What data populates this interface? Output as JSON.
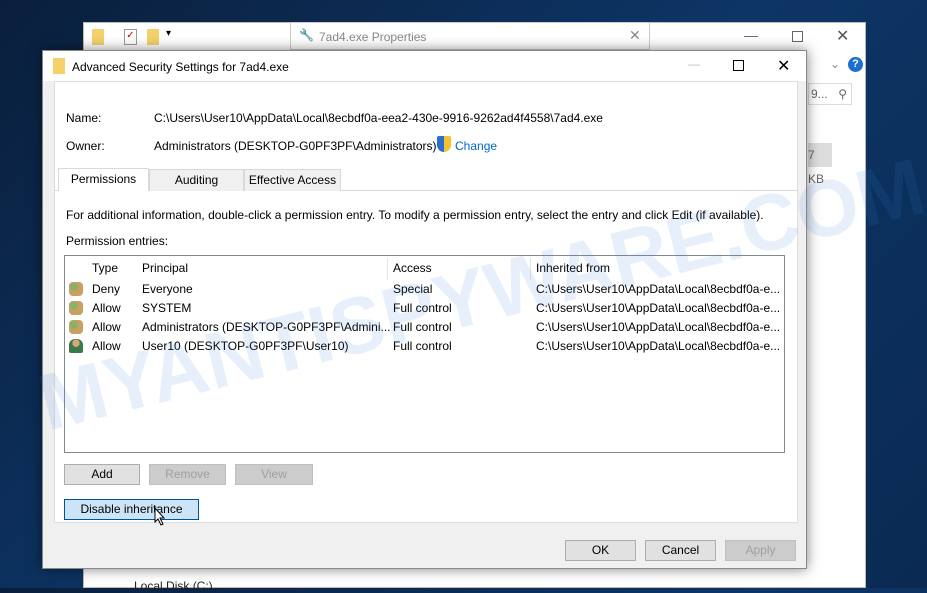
{
  "explorer": {
    "props_title": "7ad4.exe Properties",
    "search_text": "9...",
    "size_text": "7 KB",
    "nav_item": "Local Disk (C:)"
  },
  "dialog": {
    "title": "Advanced Security Settings for 7ad4.exe",
    "name_label": "Name:",
    "name_value": "C:\\Users\\User10\\AppData\\Local\\8ecbdf0a-eea2-430e-9916-9262ad4f4558\\7ad4.exe",
    "owner_label": "Owner:",
    "owner_value": "Administrators (DESKTOP-G0PF3PF\\Administrators)",
    "change_link": "Change",
    "tabs": [
      {
        "label": "Permissions"
      },
      {
        "label": "Auditing"
      },
      {
        "label": "Effective Access"
      }
    ],
    "info_text": "For additional information, double-click a permission entry. To modify a permission entry, select the entry and click Edit (if available).",
    "entries_label": "Permission entries:",
    "columns": [
      "Type",
      "Principal",
      "Access",
      "Inherited from"
    ],
    "rows": [
      {
        "icon": "group-icon",
        "type": "Deny",
        "principal": "Everyone",
        "access": "Special",
        "inherited": "C:\\Users\\User10\\AppData\\Local\\8ecbdf0a-e..."
      },
      {
        "icon": "group-icon",
        "type": "Allow",
        "principal": "SYSTEM",
        "access": "Full control",
        "inherited": "C:\\Users\\User10\\AppData\\Local\\8ecbdf0a-e..."
      },
      {
        "icon": "group-icon",
        "type": "Allow",
        "principal": "Administrators (DESKTOP-G0PF3PF\\Admini...",
        "access": "Full control",
        "inherited": "C:\\Users\\User10\\AppData\\Local\\8ecbdf0a-e..."
      },
      {
        "icon": "user-icon",
        "type": "Allow",
        "principal": "User10 (DESKTOP-G0PF3PF\\User10)",
        "access": "Full control",
        "inherited": "C:\\Users\\User10\\AppData\\Local\\8ecbdf0a-e..."
      }
    ],
    "add": "Add",
    "remove": "Remove",
    "view": "View",
    "disable_inheritance": "Disable inheritance",
    "ok": "OK",
    "cancel": "Cancel",
    "apply": "Apply"
  },
  "watermark": "MYANTISPYWARE.COM"
}
